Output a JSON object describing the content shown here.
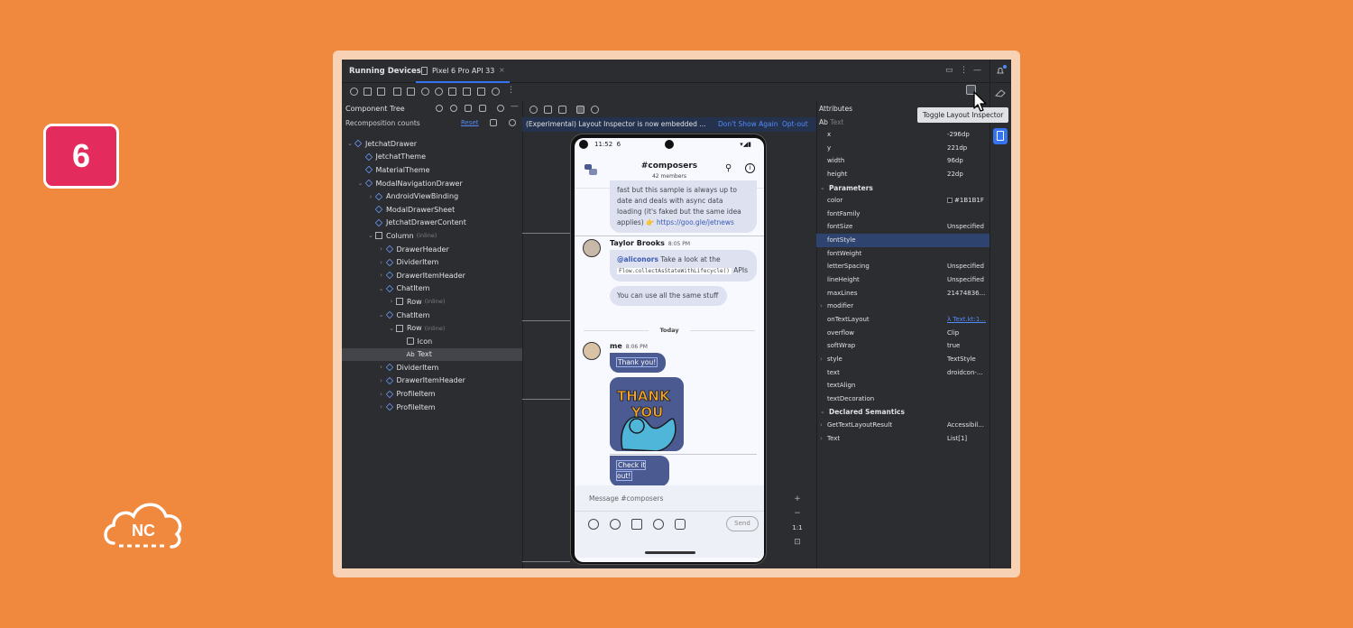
{
  "badge": {
    "step": "6"
  },
  "logo": {
    "text": "NC"
  },
  "ide": {
    "title": "Running Devices",
    "tab_label": "Pixel 6 Pro API 33",
    "tooltip": "Toggle Layout Inspector"
  },
  "component_tree": {
    "title": "Component Tree",
    "recomposition_label": "Recomposition counts",
    "reset_label": "Reset",
    "nodes": [
      {
        "label": "JetchatDrawer",
        "indent": 0,
        "chevron": "v",
        "kind": "comp"
      },
      {
        "label": "JetchatTheme",
        "indent": 1,
        "chevron": "",
        "kind": "comp"
      },
      {
        "label": "MaterialTheme",
        "indent": 1,
        "chevron": "",
        "kind": "comp"
      },
      {
        "label": "ModalNavigationDrawer",
        "indent": 1,
        "chevron": "v",
        "kind": "comp"
      },
      {
        "label": "AndroidViewBinding",
        "indent": 2,
        "chevron": ">",
        "kind": "comp"
      },
      {
        "label": "ModalDrawerSheet",
        "indent": 2,
        "chevron": "",
        "kind": "comp"
      },
      {
        "label": "JetchatDrawerContent",
        "indent": 2,
        "chevron": "",
        "kind": "comp"
      },
      {
        "label": "Column",
        "indent": 2,
        "chevron": "v",
        "kind": "col",
        "inline": "(inline)"
      },
      {
        "label": "DrawerHeader",
        "indent": 3,
        "chevron": ">",
        "kind": "comp"
      },
      {
        "label": "DividerItem",
        "indent": 3,
        "chevron": ">",
        "kind": "comp"
      },
      {
        "label": "DrawerItemHeader",
        "indent": 3,
        "chevron": ">",
        "kind": "comp"
      },
      {
        "label": "ChatItem",
        "indent": 3,
        "chevron": "v",
        "kind": "comp"
      },
      {
        "label": "Row",
        "indent": 4,
        "chevron": ">",
        "kind": "row",
        "inline": "(inline)"
      },
      {
        "label": "ChatItem",
        "indent": 3,
        "chevron": "v",
        "kind": "comp"
      },
      {
        "label": "Row",
        "indent": 4,
        "chevron": "v",
        "kind": "row",
        "inline": "(inline)"
      },
      {
        "label": "Icon",
        "indent": 5,
        "chevron": "",
        "kind": "img"
      },
      {
        "label": "Text",
        "indent": 5,
        "chevron": "",
        "kind": "text",
        "selected": true
      },
      {
        "label": "DividerItem",
        "indent": 3,
        "chevron": ">",
        "kind": "comp"
      },
      {
        "label": "DrawerItemHeader",
        "indent": 3,
        "chevron": ">",
        "kind": "comp"
      },
      {
        "label": "ProfileItem",
        "indent": 3,
        "chevron": ">",
        "kind": "comp"
      },
      {
        "label": "ProfileItem",
        "indent": 3,
        "chevron": ">",
        "kind": "comp"
      }
    ]
  },
  "banner": {
    "text": "(Experimental) Layout Inspector is now embedded ...",
    "dont_show": "Don't Show Again",
    "opt_out": "Opt-out"
  },
  "phone": {
    "status_time": "11:52",
    "status_extra": "6",
    "channel": "#composers",
    "members": "42 members",
    "msg1_text": "fast but this sample is always up to date and deals with async data loading (it's faked but the same idea applies) 👉",
    "msg1_link": "https://goo.gle/jetnews",
    "author1": "Taylor Brooks",
    "time1": "8:05 PM",
    "msg2_mention": "@aliconors",
    "msg2_text": "Take a look at the",
    "msg2_code": "Flow.collectAsStateWithLifecycle()",
    "msg2_tail": "APIs",
    "msg3": "You can use all the same stuff",
    "day": "Today",
    "author2": "me",
    "time2": "8:06 PM",
    "msg4": "Thank you!",
    "sticker_text1": "THANK",
    "sticker_text2": "YOU",
    "msg5": "Check it out!",
    "compose_placeholder": "Message #composers",
    "send": "Send"
  },
  "zoom": {
    "ratio": "1:1"
  },
  "attributes": {
    "title": "Attributes",
    "search_prefix": "Ab",
    "search_placeholder": "Text",
    "rows": [
      {
        "key": "x",
        "value": "-296dp"
      },
      {
        "key": "y",
        "value": "221dp"
      },
      {
        "key": "width",
        "value": "96dp"
      },
      {
        "key": "height",
        "value": "22dp"
      },
      {
        "key": "Parameters",
        "value": "",
        "section": true,
        "chevron": "v"
      },
      {
        "key": "color",
        "value": "#1B1B1F",
        "swatch": true
      },
      {
        "key": "fontFamily",
        "value": ""
      },
      {
        "key": "fontSize",
        "value": "Unspecified"
      },
      {
        "key": "fontStyle",
        "value": "",
        "selected": true
      },
      {
        "key": "fontWeight",
        "value": ""
      },
      {
        "key": "letterSpacing",
        "value": "Unspecified"
      },
      {
        "key": "lineHeight",
        "value": "Unspecified"
      },
      {
        "key": "maxLines",
        "value": "21474836..."
      },
      {
        "key": "modifier",
        "value": "",
        "chevron": ">"
      },
      {
        "key": "onTextLayout",
        "value": "λ Text.kt:1...",
        "link": true
      },
      {
        "key": "overflow",
        "value": "Clip"
      },
      {
        "key": "softWrap",
        "value": "true"
      },
      {
        "key": "style",
        "value": "TextStyle",
        "chevron": ">"
      },
      {
        "key": "text",
        "value": "droidcon-..."
      },
      {
        "key": "textAlign",
        "value": ""
      },
      {
        "key": "textDecoration",
        "value": ""
      },
      {
        "key": "Declared Semantics",
        "value": "",
        "section": true,
        "chevron": "v"
      },
      {
        "key": "GetTextLayoutResult",
        "value": "Accessibil...",
        "chevron": ">"
      },
      {
        "key": "Text",
        "value": "List[1]",
        "chevron": ">"
      }
    ]
  }
}
